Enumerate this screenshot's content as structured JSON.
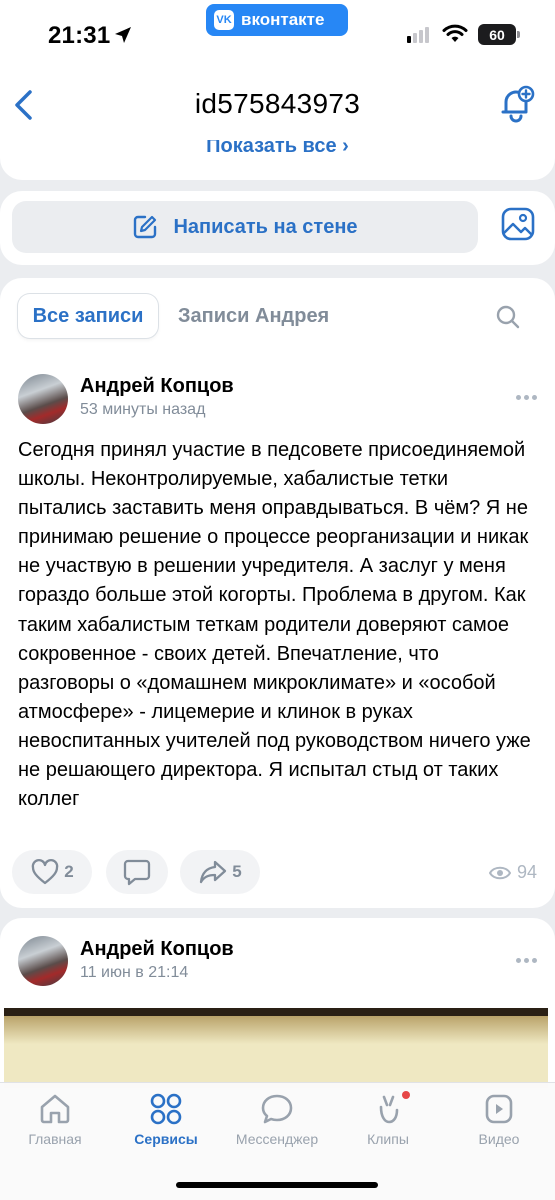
{
  "status_bar": {
    "time": "21:31",
    "app_pill": "вконтакте",
    "app_pill_logo": "VK",
    "battery": "60"
  },
  "header": {
    "title": "id575843973",
    "show_all": "Показать все"
  },
  "wall": {
    "write_label": "Написать на стене"
  },
  "tabs": {
    "active": "Все записи",
    "other": "Записи Андрея"
  },
  "posts": [
    {
      "author": "Андрей Копцов",
      "time": "53 минуты назад",
      "text": "Сегодня принял участие в педсовете присоединяемой школы. Неконтролируемые, хабалистые тетки пытались заставить меня оправдываться. В чём? Я не принимаю решение о процессе реорганизации и никак не участвую в решении учредителя. А заслуг у меня гораздо больше этой когорты. Проблема в другом. Как таким хабалистым теткам родители доверяют самое сокровенное - своих детей. Впечатление, что разговоры о «домашнем микроклимате» и «особой атмосфере» - лицемерие и клинок в руках невоспитанных учителей под руководством ничего уже не решающего директора. Я испытал стыд от таких коллег",
      "likes": "2",
      "shares": "5",
      "views": "94"
    },
    {
      "author": "Андрей Копцов",
      "time": "11 июн в 21:14"
    }
  ],
  "tabbar": [
    {
      "label": "Главная",
      "icon": "home-icon"
    },
    {
      "label": "Сервисы",
      "icon": "services-icon"
    },
    {
      "label": "Мессенджер",
      "icon": "messenger-icon"
    },
    {
      "label": "Клипы",
      "icon": "clips-icon"
    },
    {
      "label": "Видео",
      "icon": "video-icon"
    }
  ],
  "colors": {
    "accent": "#2b71c6",
    "vk_blue": "#2787f5",
    "secondary": "#818c99",
    "background": "#ebedf0"
  }
}
